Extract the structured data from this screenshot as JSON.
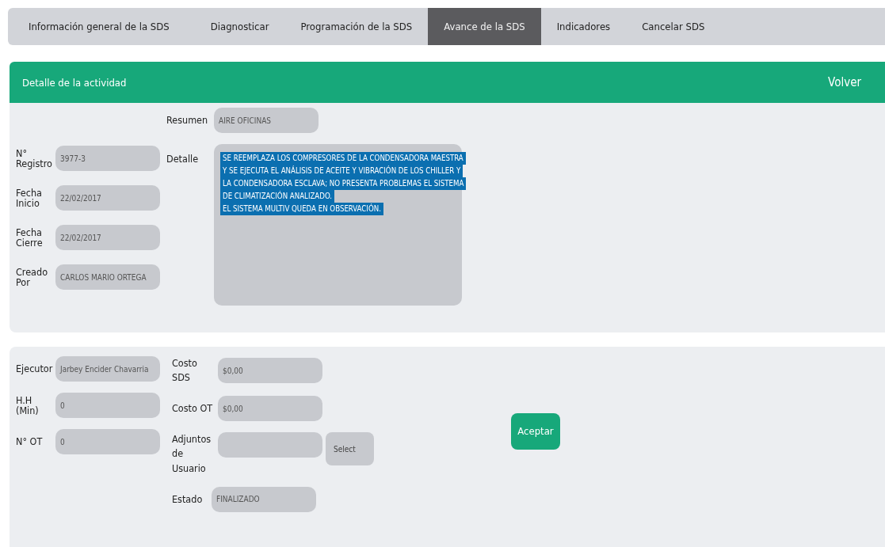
{
  "tabs": [
    {
      "label": "Información general de la SDS",
      "selected": false
    },
    {
      "label": "Diagnosticar",
      "selected": false
    },
    {
      "label": "Programación de la SDS",
      "selected": false
    },
    {
      "label": "Avance de la SDS",
      "selected": true
    },
    {
      "label": "Indicadores",
      "selected": false
    },
    {
      "label": "Cancelar SDS",
      "selected": false
    }
  ],
  "header": {
    "title": "Detalle de la actividad",
    "back": "Volver"
  },
  "activity": {
    "left_fields": [
      {
        "label": "N° Registro",
        "value": "3977-3"
      },
      {
        "label": "Fecha Inicio",
        "value": "22/02/2017"
      },
      {
        "label": "Fecha Cierre",
        "value": "22/02/2017"
      },
      {
        "label": "Creado Por",
        "value": "CARLOS MARIO ORTEGA"
      }
    ],
    "resumen": {
      "label": "Resumen",
      "value": "AIRE OFICINAS"
    },
    "detalle": {
      "label": "Detalle",
      "highlighted": true,
      "lines": [
        "SE REEMPLAZA LOS COMPRESORES DE LA CONDENSADORA MAESTRA",
        "Y SE EJECUTA EL ANÁLISIS DE ACEITE Y VIBRACIÓN DE LOS CHILLER Y",
        "LA CONDENSADORA ESCLAVA; NO PRESENTA PROBLEMAS EL SISTEMA",
        "DE CLIMATIZACIÓN ANALIZADO.",
        "EL SISTEMA MULTIV QUEDA EN OBSERVACIÓN."
      ]
    }
  },
  "execution": {
    "left_fields": [
      {
        "label": "Ejecutor",
        "value": "Jarbey Encider Chavarria"
      },
      {
        "label": "H.H (Min)",
        "value": "0"
      },
      {
        "label": "N° OT",
        "value": "0"
      }
    ],
    "right_fields": [
      {
        "label": "Costo SDS",
        "value": "$0,00"
      },
      {
        "label": "Costo OT",
        "value": "$0,00"
      }
    ],
    "attachments": {
      "label": "Adjuntos de Usuario",
      "button": "Select"
    },
    "estado": {
      "label": "Estado",
      "value": "FINALIZADO"
    },
    "accept": "Aceptar"
  }
}
